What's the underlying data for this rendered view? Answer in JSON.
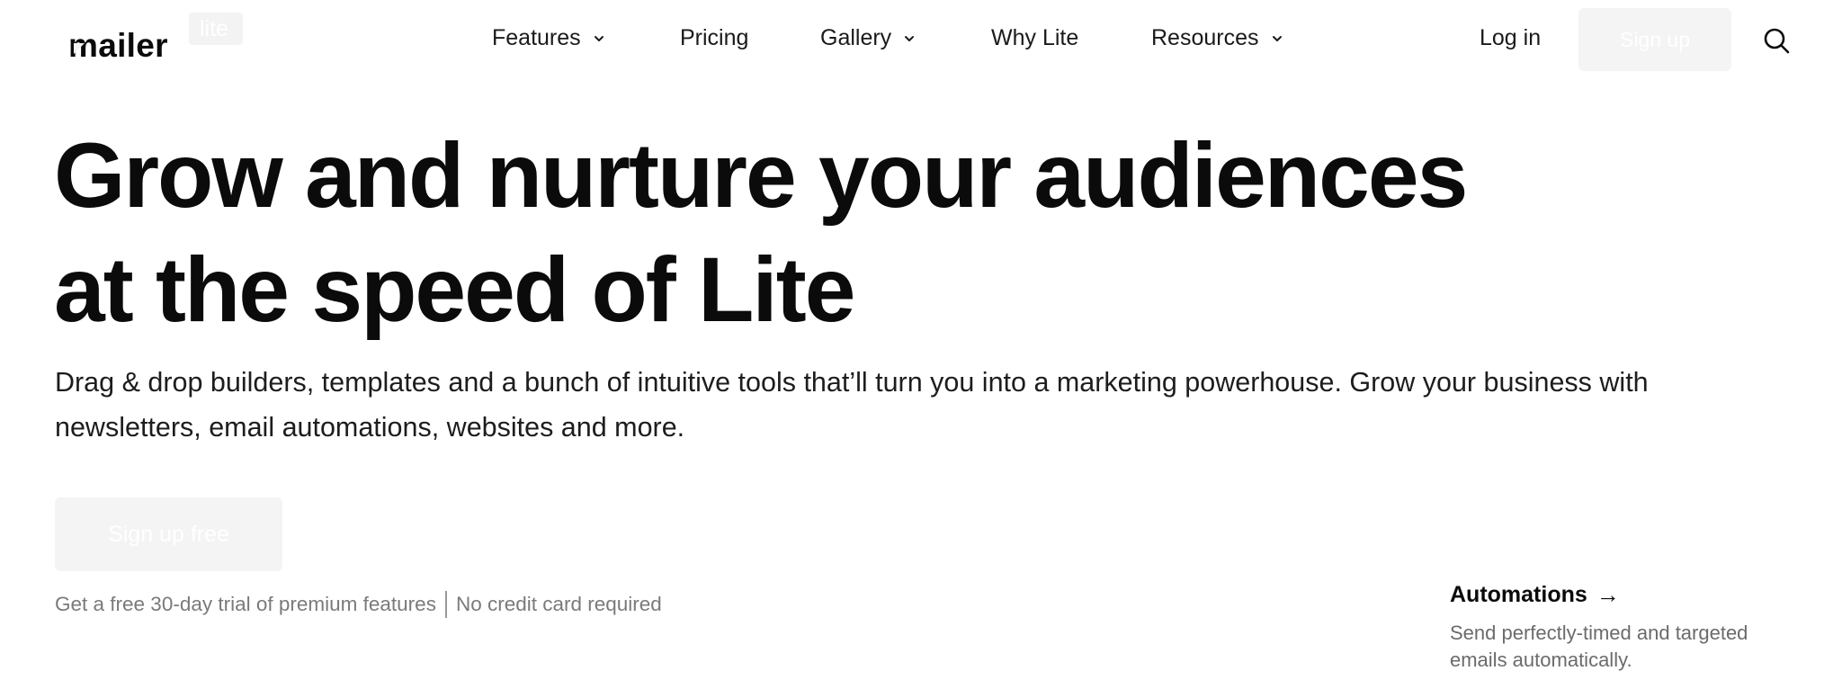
{
  "header": {
    "logo": {
      "word": "mailer",
      "badge": "lite"
    },
    "nav": [
      {
        "label": "Features",
        "has_dropdown": true
      },
      {
        "label": "Pricing",
        "has_dropdown": false
      },
      {
        "label": "Gallery",
        "has_dropdown": true
      },
      {
        "label": "Why Lite",
        "has_dropdown": false
      },
      {
        "label": "Resources",
        "has_dropdown": true
      }
    ],
    "login_label": "Log in",
    "signup_label": "Sign up",
    "search_icon": "search-icon"
  },
  "hero": {
    "title_lines": [
      "Grow and nurture your audiences",
      "at the speed of Lite"
    ],
    "subtitle_lines": [
      "Drag & drop builders, templates and a bunch of intuitive tools that’ll turn you into a marketing powerhouse. Grow your business with",
      "newsletters, email automations, websites and more."
    ],
    "cta_label": "Sign up free",
    "trial_left": "Get a free 30-day trial of premium features",
    "trial_right": "No credit card required"
  },
  "feature": {
    "title": "Automations",
    "arrow": "→",
    "desc_lines": [
      "Send perfectly-timed and targeted",
      "emails automatically."
    ]
  },
  "colors": {
    "text": "#0b0b0b",
    "muted": "#7a7a7a",
    "button_bg": "#f4f4f4",
    "button_text": "#ffffff"
  }
}
